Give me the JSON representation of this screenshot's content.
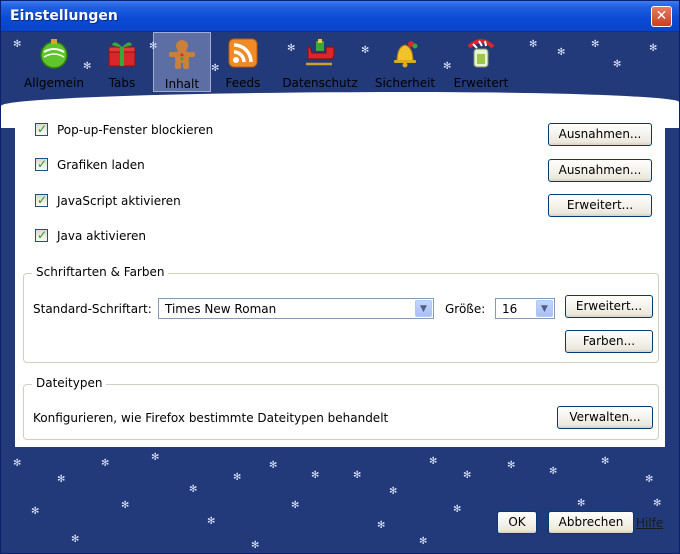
{
  "window": {
    "title": "Einstellungen"
  },
  "colors": {
    "titlebar": "#0a4ad4",
    "toolbar_bg": "#233a7a",
    "close": "#c93e22",
    "accent_check": "#21a121"
  },
  "tabs": [
    {
      "label": "Allgemein",
      "icon": "christmas-ornament-icon"
    },
    {
      "label": "Tabs",
      "icon": "gift-box-icon"
    },
    {
      "label": "Inhalt",
      "icon": "gingerbread-man-icon",
      "selected": true
    },
    {
      "label": "Feeds",
      "icon": "rss-feed-icon"
    },
    {
      "label": "Datenschutz",
      "icon": "sleigh-icon"
    },
    {
      "label": "Sicherheit",
      "icon": "bell-icon"
    },
    {
      "label": "Erweitert",
      "icon": "candy-jar-icon"
    }
  ],
  "content": {
    "checkboxes": [
      {
        "label": "Pop-up-Fenster blockieren",
        "checked": true,
        "button": "Ausnahmen..."
      },
      {
        "label": "Grafiken laden",
        "checked": true,
        "button": "Ausnahmen..."
      },
      {
        "label": "JavaScript aktivieren",
        "checked": true,
        "button": "Erweitert..."
      },
      {
        "label": "Java aktivieren",
        "checked": true
      }
    ],
    "fonts": {
      "group_label": "Schriftarten & Farben",
      "default_font_label": "Standard-Schriftart:",
      "default_font_value": "Times New Roman",
      "size_label": "Größe:",
      "size_value": "16",
      "advanced_button": "Erweitert...",
      "colors_button": "Farben..."
    },
    "filetypes": {
      "group_label": "Dateitypen",
      "description": "Konfigurieren, wie Firefox bestimmte Dateitypen behandelt",
      "manage_button": "Verwalten..."
    }
  },
  "footer": {
    "ok": "OK",
    "cancel": "Abbrechen",
    "help": "Hilfe"
  }
}
